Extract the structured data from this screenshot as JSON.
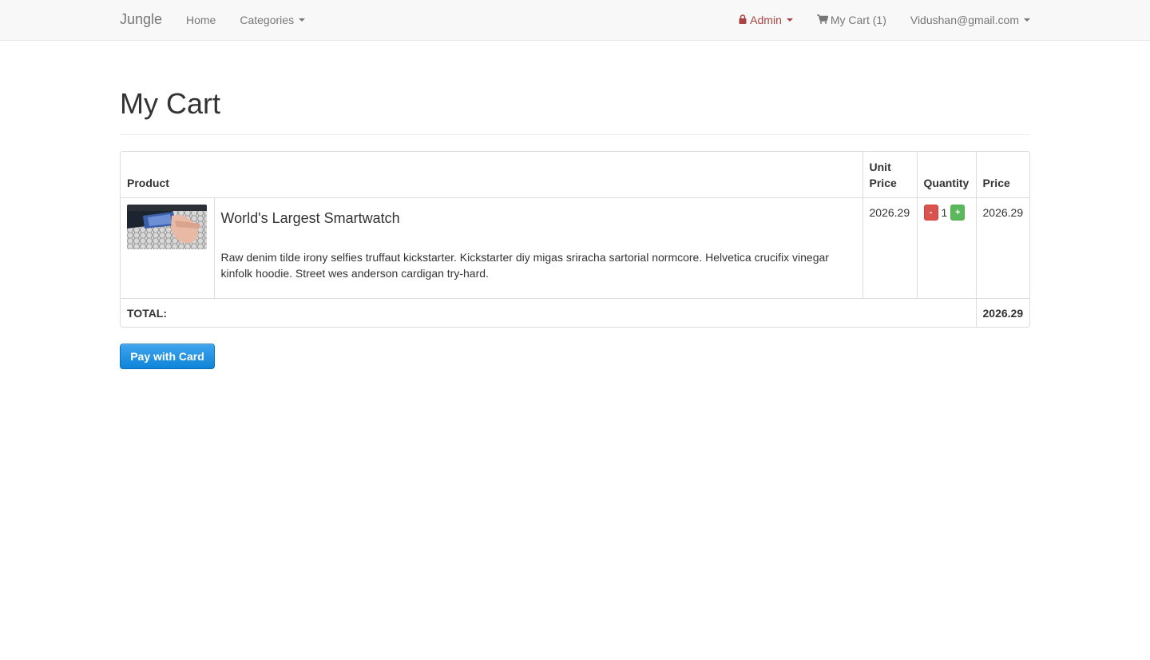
{
  "navbar": {
    "brand": "Jungle",
    "left_links": [
      {
        "label": "Home"
      },
      {
        "label": "Categories"
      }
    ],
    "right_links": [
      {
        "label": "Admin",
        "icon": "lock-icon",
        "color": "#a94442"
      },
      {
        "label": "My Cart (1)",
        "icon": "cart-icon"
      },
      {
        "label": "Vidushan@gmail.com"
      }
    ]
  },
  "page": {
    "title": "My Cart"
  },
  "cart_table": {
    "headers": {
      "product": "Product",
      "unit_price": "Unit Price",
      "quantity": "Quantity",
      "price": "Price"
    },
    "items": [
      {
        "name": "World's Largest Smartwatch",
        "description": "Raw denim tilde irony selfies truffaut kickstarter. Kickstarter diy migas sriracha sartorial normcore. Helvetica crucifix vinegar kinfolk hoodie. Street wes anderson cardigan try-hard.",
        "unit_price": "2026.29",
        "quantity": "1",
        "price": "2026.29",
        "minus_label": "-",
        "plus_label": "+"
      }
    ],
    "total_label": "TOTAL:",
    "total_value": "2026.29"
  },
  "pay_button": {
    "label": "Pay with Card",
    "color": "#1a8ee0"
  }
}
